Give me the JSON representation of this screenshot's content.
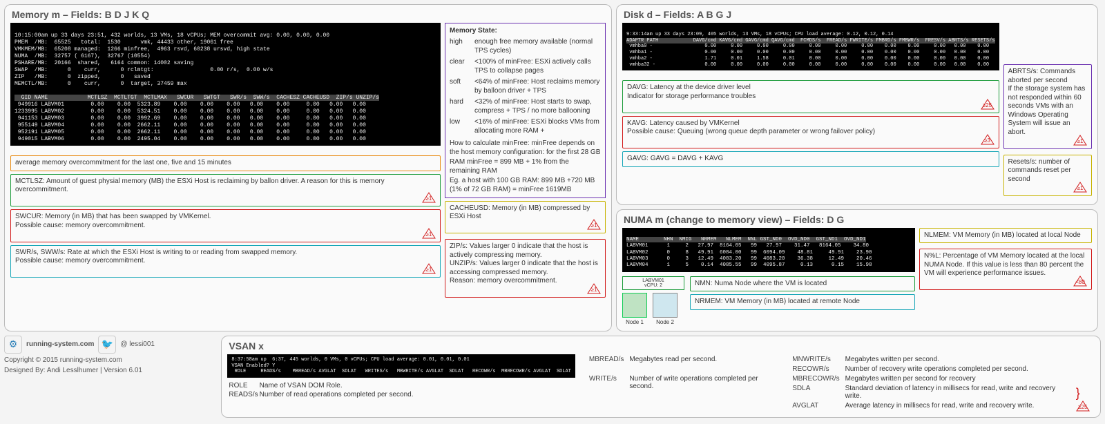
{
  "memory": {
    "title": "Memory m – Fields: B D J K Q",
    "term_header": "10:15:00am up 33 days 23:51, 432 worlds, 13 VMs, 18 vCPUs; MEM overcommit avg: 0.00, 0.00, 0.00",
    "term_lines": "PMEM  /MB:  65525   total:  1530      vmk, 44433 other, 19061 free\nVMKMEM/MB:  65208 managed:  1266 minfree,  4963 rsvd, 60238 ursvd, high state\nNUMA  /MB:  32757 ( 6167),  32767 (10554)\nPSHARE/MB:  20166  shared,   6164 common: 14002 saving\nSWAP  /MB:      0    curr,      0 rclmtgt:                 0.00 r/s,  0.00 w/s\nZIP   /MB:      0  zipped,      0   saved\nMEMCTL/MB:      0    curr,      0  target, 37459 max",
    "term_table_head": "  GID NAME            MCTLSZ  MCTLTGT  MCTLMAX   SWCUR   SWTGT   SWR/s  SWW/s  CACHESZ CACHEUSD  ZIP/s UNZIP/s",
    "term_rows": [
      " 949916 LABVM01        0.00    0.00  5323.89    0.00    0.00    0.00   0.00    0.00     0.00   0.00   0.00",
      "1233995 LABVM02        0.00    0.00  5324.51    0.00    0.00    0.00   0.00    0.00     0.00   0.00   0.00",
      " 941153 LABVM03        0.00    0.00  3992.69    0.00    0.00    0.00   0.00    0.00     0.00   0.00   0.00",
      " 955149 LABVM04        0.00    0.00  2662.11    0.00    0.00    0.00   0.00    0.00     0.00   0.00   0.00",
      " 952191 LABVM05        0.00    0.00  2662.11    0.00    0.00    0.00   0.00    0.00     0.00   0.00   0.00",
      " 949015 LABVM06        0.00    0.00  2495.04    0.00    0.00    0.00   0.00    0.00     0.00   0.00   0.00"
    ],
    "callouts": {
      "overcommit": "average memory overcommitment for the last one, five and 15 minutes",
      "mctlsz": "MCTLSZ: Amount of guest physial memory (MB) the ESXi Host is reclaiming by ballon driver. A reason for this is memory overcommitment.",
      "swcur": "SWCUR: Memory (in MB) that has been swapped by VMKernel.\nPossible cause: memory overcommitment.",
      "swrws": "SWR/s, SWW/s: Rate at which the ESXi Host is writing to or reading from swapped memory.\nPossible cause: memory overcommitment.",
      "cacheusd": "CACHEUSD: Memory (in MB) compressed by ESXi Host",
      "zip": "ZIP/s: Values larger 0 indicate that the host is actively compressing memory.\nUNZIP/s: Values larger 0 indicate that the host is accessing compressed memory.\nReason: memory overcommitment."
    },
    "mem_state_title": "Memory State:",
    "mem_state": {
      "high": "enough free memory available (normal TPS cycles)",
      "clear": "<100% of minFree: ESXi actively calls TPS to collapse pages",
      "soft": "<64% of minFree: Host reclaims memory by balloon driver + TPS",
      "hard": "<32% of minFree: Host starts to swap, compress + TPS / no more ballooning",
      "low": "<16% of minFree: ESXi blocks VMs from allocating more RAM +"
    },
    "minfree_text": "How to calculate minFree: minFree depends on the host memory configuration: for the first 28 GB RAM minFree = 899 MB + 1% from the remaining RAM\nEg. a host with 100 GB RAM: 899 MB +720 MB (1% of 72 GB RAM) = minFree 1619MB",
    "thresholds": {
      "gt1": "≥1"
    }
  },
  "disk": {
    "title": "Disk d – Fields: A B G J",
    "term_header": "9:33:14am up 33 days 23:09, 405 worlds, 13 VMs, 18 vCPUs; CPU load average: 0.12, 0.12, 0.14",
    "term_table_head": "ADAPTR PATH            DAVG/cmd KAVG/cmd GAVG/cmd QAVG/cmd  FCMDS/s  FREAD/s FWRITE/s FMBRD/s FMBWR/s  FRESV/s ABRTS/s RESETS/s",
    "term_rows": [
      " vmhba0 -                  0.00     0.00     0.00     0.00     0.00     0.00     0.00    0.00    0.00     0.00   0.00    0.00",
      " vmhba1 -                  0.00     0.00     0.00     0.00     0.00     0.00     0.00    0.00    0.00     0.00   0.00    0.00",
      " vmhba2 -                  1.71     0.01     1.58     0.01     0.00     0.00     0.00    0.00    0.00     0.00   0.00    0.00",
      " vmhba32 -                 0.00     0.00     0.00     0.00     0.00     0.00     0.00    0.00    0.00     0.00   0.00    0.00"
    ],
    "callouts": {
      "davg": "DAVG: Latency at the device driver level\nIndicator for storage performance troubles",
      "kavg": "KAVG: Latency caused by VMKernel\nPossible cause: Queuing (wrong queue depth parameter or wrong failover policy)",
      "gavg": "GAVG: GAVG = DAVG + KAVG",
      "abrts": "ABRTS/s: Commands aborted per second\nIf the storage system has not responded within 60 seconds VMs with an Windows Operating System will issue an abort.",
      "resets": "Resets/s: number of commands reset per second"
    },
    "thresholds": {
      "davg": "≥25",
      "kavg": "≥3",
      "abrts": "≥1",
      "resets": "≥1"
    }
  },
  "numa": {
    "title": "NUMA m (change to memory view) – Fields: D G",
    "term_table_head": "NAME        NHN  NMIG   NRMEM   NLMEM  N%L GST_ND0  OVD_ND0  GST_ND1  OVD_ND1",
    "term_rows": [
      "LABVM01      1     2   27.97  8164.05   99   27.97    31.47   8164.05    34.80",
      "LABVM02      0     8   49.91  6084.00   99  6094.09    48.81     49.91    23.90",
      "LABVM03      0     3   12.49  4083.20   99  4083.20    36.38     12.49    20.46",
      "LABVM04      1     5    0.14  4085.55   99  4095.87     0.13      0.15    15.98"
    ],
    "callouts": {
      "nmn": "NMN: Numa Node where the VM is located",
      "nrmem": "NRMEM: VM Memory (in MB) located at remote Node",
      "nlmem": "NLMEM: VM Memory (in MB) located at local Node",
      "nl": "N%L: Percentage of VM Memory located at the local NUMA Node. If this value is less than 80 percent the VM will experience performance issues."
    },
    "thresholds": {
      "nl": "<80"
    },
    "nodes": {
      "n1": "Node 1",
      "n2": "Node 2",
      "vm": "LABVM01\nvCPU: 2"
    }
  },
  "vsan": {
    "title": "VSAN x",
    "term": "8:37:58am up  6:37, 445 worlds, 0 VMs, 0 vCPUs; CPU load average: 0.01, 0.01, 0.01\nVSAN Enabled? Y\n ROLE     READS/s    MBREAD/s AVGLAT  SDLAT   WRITES/s   MBWRITE/s AVGLAT  SDLAT   RECOWR/s  MBRECOWR/s AVGLAT  SDLAT",
    "defs": {
      "role": "Name of VSAN DOM Role.",
      "reads": "Number of read operations completed per second.",
      "mbread": "Megabytes read per second.",
      "writes": "Number of write operations completed per second.",
      "mnwrite": "Megabytes written per second.",
      "recowr": "Number of recovery write operations completed per second.",
      "mbrecowr": "Megabytes written per second for recovery",
      "sdla": "Standard deviation of latency in millisecs for read, write and recovery write.",
      "avglat": "Average latency in millisecs for read, write and recovery write."
    },
    "threshold": "≥25"
  },
  "footer": {
    "site": "running-system.com",
    "handle": "@ lessi001",
    "copyright": "Copyright © 2015 running-system.com",
    "designed": "Designed By: Andi Lesslhumer | Version 6.01"
  }
}
